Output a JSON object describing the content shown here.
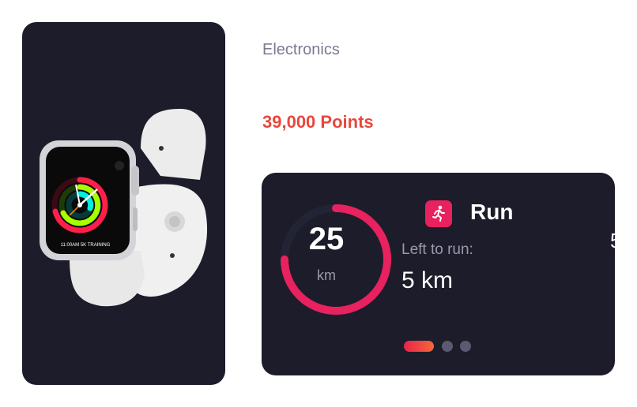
{
  "product": {
    "category": "Electronics",
    "points": "39,000 Points",
    "image_description_icon": "smartwatch-image",
    "watch_face_text": "11:00AM 5K TRAINING"
  },
  "run_card": {
    "title": "Run",
    "icon": "running-person-icon",
    "ring_value": "25",
    "ring_unit": "km",
    "ring_progress": 0.75,
    "left_label": "Left to run:",
    "left_value": "5 km",
    "pagination": {
      "active": 0,
      "count": 3
    },
    "colors": {
      "accent": "#e8215f",
      "ring_track": "#232336",
      "card_bg": "#1c1c2a"
    }
  },
  "colors": {
    "points": "#e8473c",
    "category": "#7b7a93"
  }
}
